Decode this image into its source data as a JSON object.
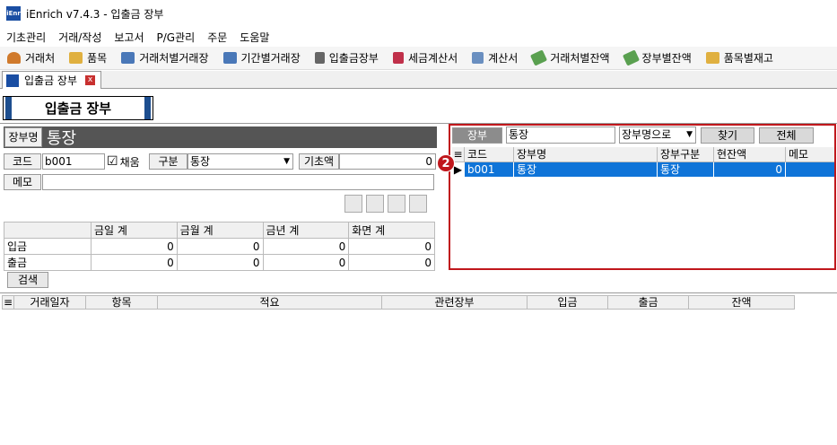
{
  "app": {
    "logo_text": "iEnr",
    "title": "iEnrich v7.4.3 - 입출금 장부"
  },
  "menu": [
    "기초관리",
    "거래/작성",
    "보고서",
    "P/G관리",
    "주문",
    "도움말"
  ],
  "toolbar": [
    {
      "label": "거래처",
      "icon": "person-icon",
      "color": "#d07a2c"
    },
    {
      "label": "품목",
      "icon": "box-icon",
      "color": "#e0b040"
    },
    {
      "label": "거래처별거래장",
      "icon": "ledger-icon",
      "color": "#4a78b8"
    },
    {
      "label": "기간별거래장",
      "icon": "ledger-icon",
      "color": "#4a78b8"
    },
    {
      "label": "입출금장부",
      "icon": "calculator-icon",
      "color": "#666666"
    },
    {
      "label": "세금계산서",
      "icon": "invoice-icon",
      "color": "#c0304a"
    },
    {
      "label": "계산서",
      "icon": "document-icon",
      "color": "#6a8fc0"
    },
    {
      "label": "거래처별잔액",
      "icon": "money-icon",
      "color": "#5aa050"
    },
    {
      "label": "장부별잔액",
      "icon": "money-icon",
      "color": "#5aa050"
    },
    {
      "label": "품목별재고",
      "icon": "box-icon",
      "color": "#e0b040"
    }
  ],
  "doctab": {
    "label": "입출금 장부",
    "close": "x"
  },
  "page_title": "입출금 장부",
  "form": {
    "name_label": "장부명",
    "name_value": "통장",
    "code_label": "코드",
    "code_value": "b001",
    "auto_label": "채움",
    "auto_checked": "☑",
    "type_label": "구분",
    "type_value": "통장",
    "opening_label": "기초액",
    "opening_value": "0",
    "memo_label": "메모",
    "memo_value": ""
  },
  "summary": {
    "headers": [
      "",
      "금일 계",
      "금월 계",
      "금년 계",
      "화면 계"
    ],
    "rows": [
      [
        "입금",
        "0",
        "0",
        "0",
        "0"
      ],
      [
        "출금",
        "0",
        "0",
        "0",
        "0"
      ]
    ]
  },
  "search_label": "검색",
  "right_panel": {
    "ledger_label": "장부",
    "search_value": "통장",
    "search_mode": "장부명으로",
    "find_label": "찾기",
    "all_label": "전체",
    "columns": [
      "코드",
      "장부명",
      "장부구분",
      "현잔액",
      "메모"
    ],
    "rows": [
      {
        "code": "b001",
        "name": "통장",
        "type": "통장",
        "balance": "0",
        "memo": ""
      }
    ],
    "badge": "2"
  },
  "transactions": {
    "columns": [
      "거래일자",
      "항목",
      "적요",
      "관련장부",
      "입금",
      "출금",
      "잔액"
    ]
  }
}
